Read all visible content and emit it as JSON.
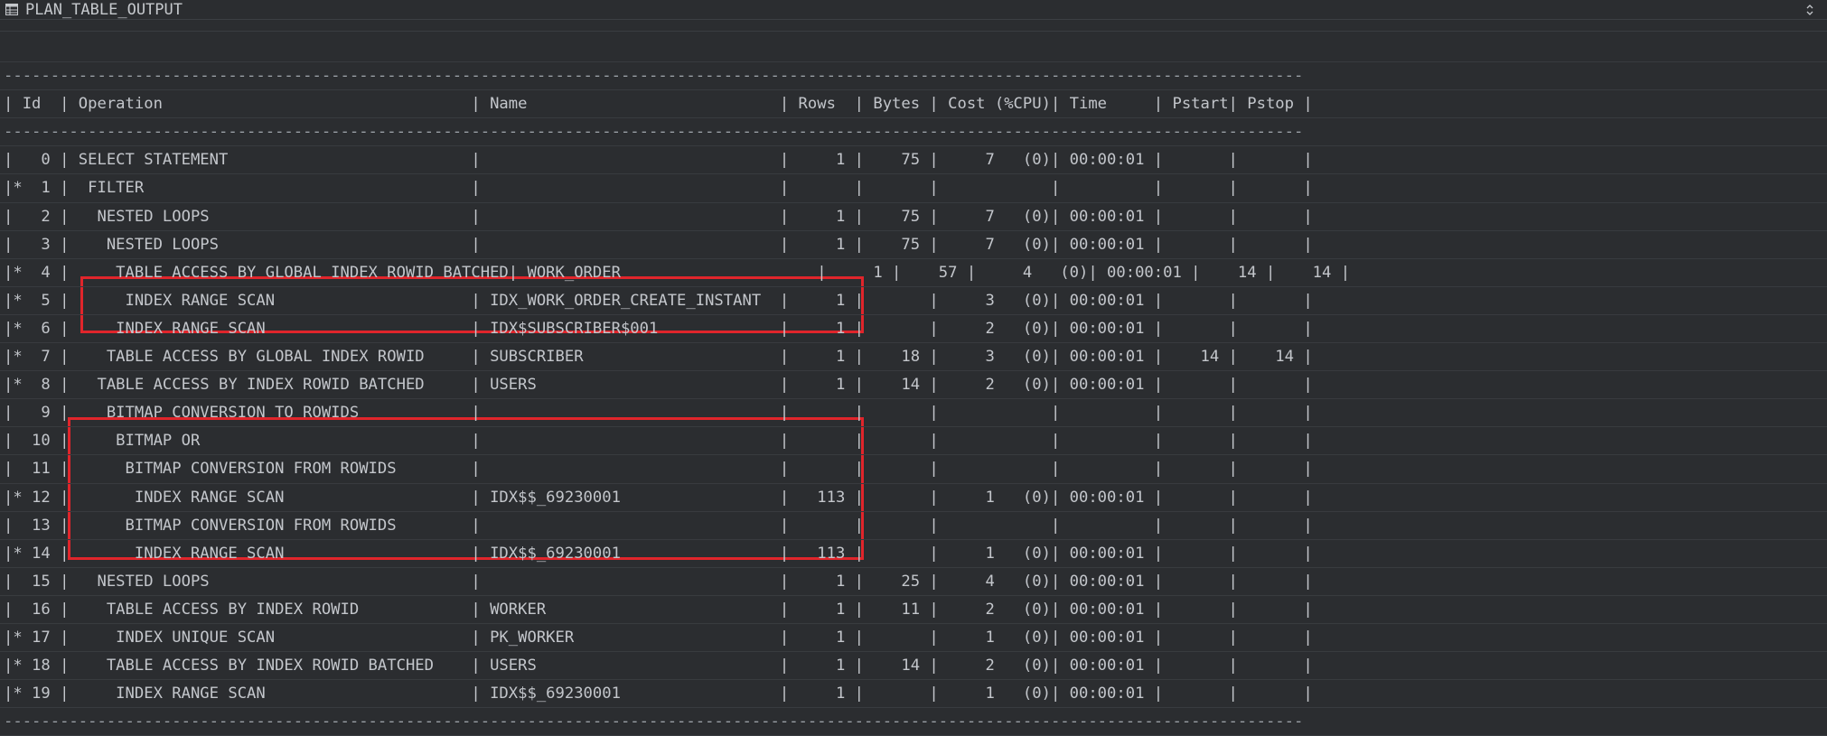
{
  "header": {
    "column_title": "PLAN_TABLE_OUTPUT"
  },
  "plan_lines": [
    "",
    "-------------------------------------------------------------------------------------------------------------------------------------------",
    "| Id  | Operation                                 | Name                           | Rows  | Bytes | Cost (%CPU)| Time     | Pstart| Pstop |",
    "-------------------------------------------------------------------------------------------------------------------------------------------",
    "|   0 | SELECT STATEMENT                          |                                |     1 |    75 |     7   (0)| 00:00:01 |       |       |",
    "|*  1 |  FILTER                                   |                                |       |       |            |          |       |       |",
    "|   2 |   NESTED LOOPS                            |                                |     1 |    75 |     7   (0)| 00:00:01 |       |       |",
    "|   3 |    NESTED LOOPS                           |                                |     1 |    75 |     7   (0)| 00:00:01 |       |       |",
    "|*  4 |     TABLE ACCESS BY GLOBAL INDEX ROWID BATCHED| WORK_ORDER                     |     1 |    57 |     4   (0)| 00:00:01 |    14 |    14 |",
    "|*  5 |      INDEX RANGE SCAN                     | IDX_WORK_ORDER_CREATE_INSTANT  |     1 |       |     3   (0)| 00:00:01 |       |       |",
    "|*  6 |     INDEX RANGE SCAN                      | IDX$SUBSCRIBER$001             |     1 |       |     2   (0)| 00:00:01 |       |       |",
    "|*  7 |    TABLE ACCESS BY GLOBAL INDEX ROWID     | SUBSCRIBER                     |     1 |    18 |     3   (0)| 00:00:01 |    14 |    14 |",
    "|*  8 |   TABLE ACCESS BY INDEX ROWID BATCHED     | USERS                          |     1 |    14 |     2   (0)| 00:00:01 |       |       |",
    "|   9 |    BITMAP CONVERSION TO ROWIDS            |                                |       |       |            |          |       |       |",
    "|  10 |     BITMAP OR                             |                                |       |       |            |          |       |       |",
    "|  11 |      BITMAP CONVERSION FROM ROWIDS        |                                |       |       |            |          |       |       |",
    "|* 12 |       INDEX RANGE SCAN                    | IDX$$_69230001                 |   113 |       |     1   (0)| 00:00:01 |       |       |",
    "|  13 |      BITMAP CONVERSION FROM ROWIDS        |                                |       |       |            |          |       |       |",
    "|* 14 |       INDEX RANGE SCAN                    | IDX$$_69230001                 |   113 |       |     1   (0)| 00:00:01 |       |       |",
    "|  15 |   NESTED LOOPS                            |                                |     1 |    25 |     4   (0)| 00:00:01 |       |       |",
    "|  16 |    TABLE ACCESS BY INDEX ROWID            | WORKER                         |     1 |    11 |     2   (0)| 00:00:01 |       |       |",
    "|* 17 |     INDEX UNIQUE SCAN                     | PK_WORKER                      |     1 |       |     1   (0)| 00:00:01 |       |       |",
    "|* 18 |    TABLE ACCESS BY INDEX ROWID BATCHED    | USERS                          |     1 |    14 |     2   (0)| 00:00:01 |       |       |",
    "|* 19 |     INDEX RANGE SCAN                      | IDX$$_69230001                 |     1 |       |     1   (0)| 00:00:01 |       |       |",
    "-------------------------------------------------------------------------------------------------------------------------------------------"
  ],
  "highlight_color": "#e0252b",
  "icons": {
    "column_icon": "table-grid-icon",
    "sort_icon": "sort-arrows-icon"
  }
}
